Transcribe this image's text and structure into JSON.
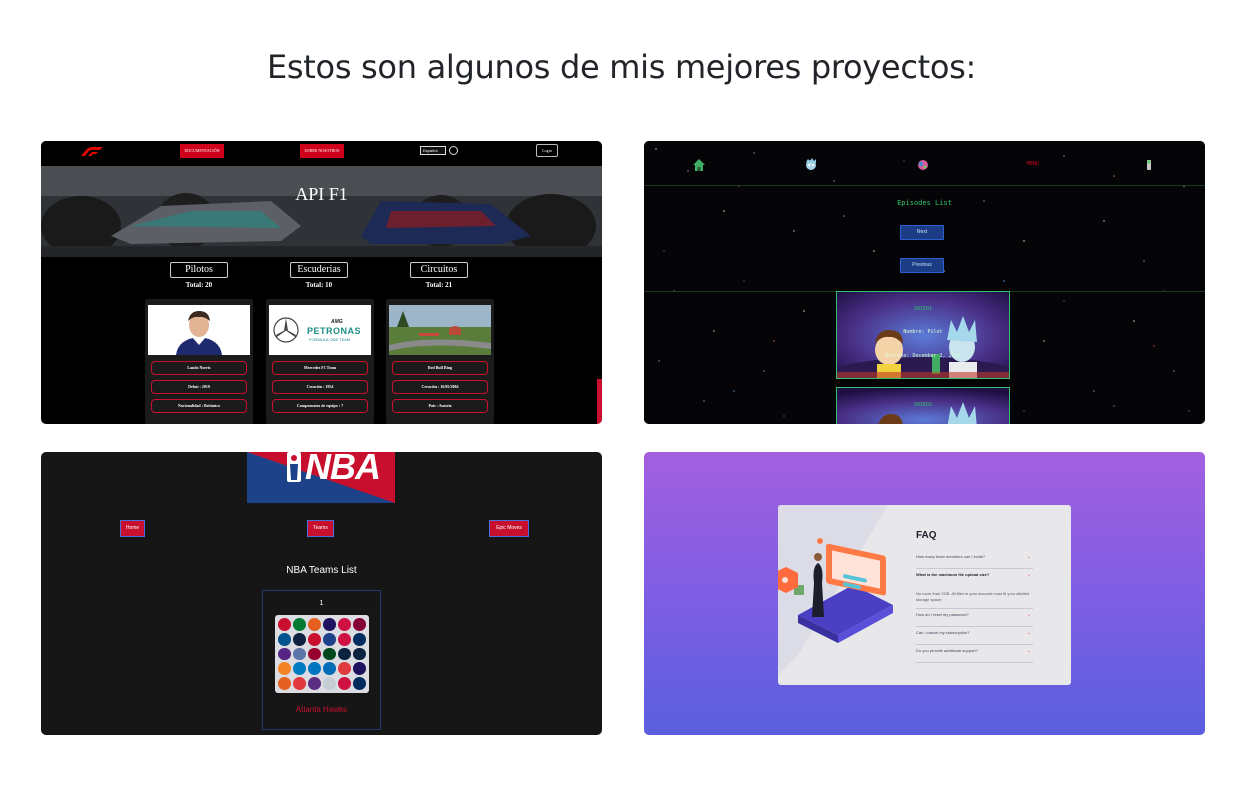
{
  "heading": "Estos son algunos de mis mejores proyectos:",
  "projects": {
    "f1": {
      "nav": {
        "documentation_label": "DOCUMENTACIÓN",
        "about_label": "SOBRE NOSOTROS",
        "language_value": "Español",
        "login_label": "Login"
      },
      "hero_title": "API F1",
      "tabs": [
        {
          "label": "Pilotos",
          "total": "Total: 20"
        },
        {
          "label": "Escuderías",
          "total": "Total: 10"
        },
        {
          "label": "Circuitos",
          "total": "Total: 21"
        }
      ],
      "cards": [
        {
          "fields": [
            "Lando Norris",
            "Debut : 2019",
            "Nacionalidad : Británico"
          ]
        },
        {
          "fields": [
            "Mercedes F1 Team",
            "Creación : 1954",
            "Campeonatos de equipo : 7"
          ]
        },
        {
          "fields": [
            "Red Bull Ring",
            "Creación : 16/05/2004",
            "País : Austria"
          ]
        }
      ],
      "mercedes_logo_text": "PETRONAS",
      "mercedes_logo_sub": "FORMULA ONE TEAM",
      "mercedes_logo_top": "AMG"
    },
    "rick_morty": {
      "menu_label": "MENU",
      "title": "Episodes List",
      "next_label": "Next",
      "previous_label": "Previous",
      "episodes": [
        {
          "code": "S01E01",
          "name": "Nombre: Pilot",
          "date": "Estreno: December 2, 2013"
        },
        {
          "code": "S01E02"
        }
      ]
    },
    "nba": {
      "logo_text": "NBA",
      "nav": [
        "Home",
        "Teams",
        "Epic Moves"
      ],
      "title": "NBA Teams List",
      "card_number": "1",
      "team_name": "Atlanta Hawks"
    },
    "faq": {
      "heading": "FAQ",
      "questions": [
        "How many team members can I invite?",
        "What is the maximum file upload size?",
        "How do I reset my password?",
        "Can I cancel my subscription?",
        "Do you provide additional support?"
      ],
      "answer": "No more than 2GB. All files in your account must fit your allotted storage space."
    }
  }
}
